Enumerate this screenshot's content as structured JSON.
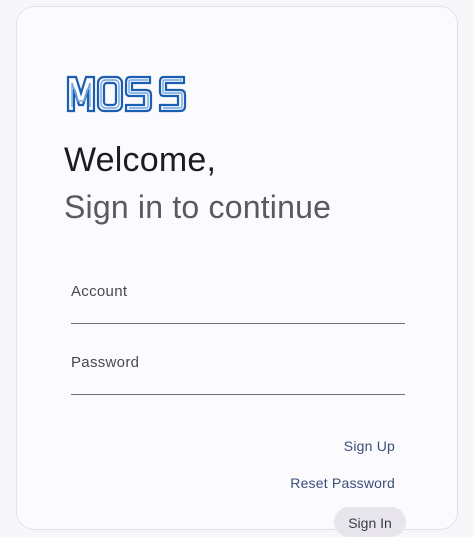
{
  "brand": {
    "logo_text": "MOSS",
    "logo_color": "#1a5fb4"
  },
  "header": {
    "welcome": "Welcome,",
    "subtitle": "Sign in to continue"
  },
  "form": {
    "account_label": "Account",
    "account_value": "",
    "password_label": "Password",
    "password_value": ""
  },
  "actions": {
    "sign_up": "Sign Up",
    "reset_password": "Reset Password",
    "sign_in": "Sign In"
  },
  "colors": {
    "background": "#f7f6f9",
    "text_primary": "#1d1b20",
    "text_secondary": "#5a5860",
    "link": "#3c4e7a"
  }
}
